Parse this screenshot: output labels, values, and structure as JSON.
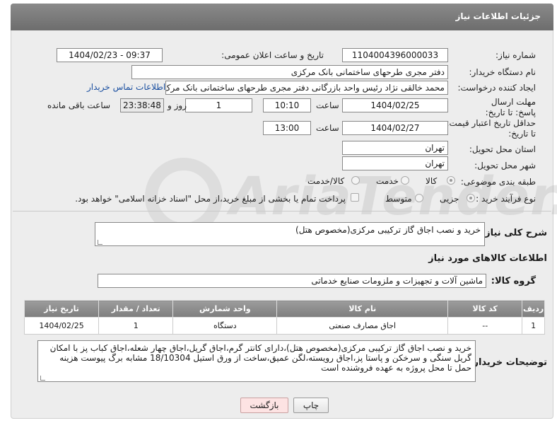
{
  "header": {
    "title": "جزئیات اطلاعات نیاز"
  },
  "fields": {
    "need_number": {
      "label": "شماره نیاز:",
      "value": "1104004396000033"
    },
    "announce_datetime": {
      "label": "تاریخ و ساعت اعلان عمومی:",
      "value": "1404/02/23 - 09:37"
    },
    "buyer_org": {
      "label": "نام دستگاه خریدار:",
      "value": "دفتر مجری طرحهای ساختمانی بانک مرکزی"
    },
    "requester": {
      "label": "ایجاد کننده درخواست:",
      "value": "محمد خالقی نژاد رئیس واحد بازرگانی دفتر مجری طرحهای ساختمانی بانک مرک",
      "contact_link": "اطلاعات تماس خریدار"
    },
    "deadline": {
      "label": "مهلت ارسال پاسخ: تا تاریخ:",
      "date": "1404/02/25",
      "time_label": "ساعت",
      "time": "10:10",
      "days": "1",
      "days_label": "روز و",
      "remaining": "23:38:48",
      "remaining_label": "ساعت باقی مانده"
    },
    "price_validity": {
      "label": "حداقل تاریخ اعتبار قیمت: تا تاریخ:",
      "date": "1404/02/27",
      "time_label": "ساعت",
      "time": "13:00"
    },
    "province": {
      "label": "استان محل تحویل:",
      "value": "تهران"
    },
    "city": {
      "label": "شهر محل تحویل:",
      "value": "تهران"
    },
    "category": {
      "label": "طبقه بندی موضوعی:",
      "options": [
        "کالا",
        "خدمت",
        "کالا/خدمت"
      ],
      "selected": "کالا"
    },
    "process_type": {
      "label": "نوع فرآیند خرید :",
      "options": [
        "جزیی",
        "متوسط"
      ],
      "selected": "جزیی",
      "payment_note": "پرداخت تمام یا بخشی از مبلغ خرید،از محل \"اسناد خزانه اسلامی\" خواهد بود."
    }
  },
  "description": {
    "label": "شرح کلی نیاز:",
    "value": "خرید و نصب اجاق گاز ترکیبی مرکزی(مخصوص هتل)"
  },
  "goods_info": {
    "title": "اطلاعات کالاهای مورد نیاز",
    "group_label": "گروه کالا:",
    "group_value": "ماشین آلات و تجهیزات و ملزومات صنایع خدماتی"
  },
  "table": {
    "headers": [
      "ردیف",
      "کد کالا",
      "نام کالا",
      "واحد شمارش",
      "تعداد / مقدار",
      "تاریخ نیاز"
    ],
    "rows": [
      [
        "1",
        "--",
        "اجاق مصارف صنعتی",
        "دستگاه",
        "1",
        "1404/02/25"
      ]
    ]
  },
  "buyer_notes": {
    "label": "توضیحات خریدار:",
    "value": "خرید و نصب اجاق گاز ترکیبی مرکزی(مخصوص هتل)،دارای کانتر گرم،اجاق گریل،اجاق چهار شعله،اجاق کباب پز با امکان گریل سنگی و سرخکن و پاستا پز،اجاق رویسته،لگن عمیق،ساخت از ورق استیل 18/10304 مشابه برگ پیوست هزینه حمل تا محل پروژه به عهده فروشنده است"
  },
  "buttons": {
    "print": "چاپ",
    "back": "بازگشت"
  },
  "watermark": "AriaTender.net"
}
